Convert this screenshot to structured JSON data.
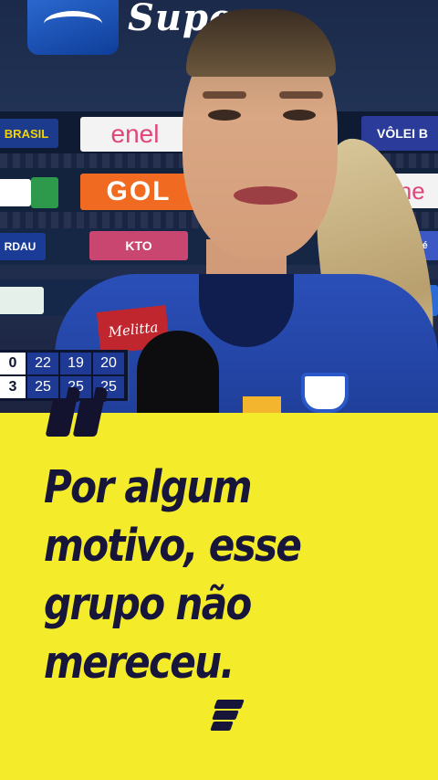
{
  "video": {
    "top_logo_text": "Super",
    "boards": {
      "brasil": "BRASIL",
      "enel1": "enel",
      "volei": "VÔLEI B",
      "red1": "",
      "gol": "GOL",
      "enel2": "ene",
      "rdau": "RDAU",
      "kto": "KTO",
      "itambe": "itambé",
      "red2": ""
    },
    "sponsor": "Melitta",
    "scoreboard": {
      "row1": {
        "sets": "0",
        "points": [
          "22",
          "19",
          "20"
        ]
      },
      "row2": {
        "sets": "3",
        "points": [
          "25",
          "25",
          "25"
        ]
      }
    }
  },
  "quote": {
    "lines": [
      "Por algum",
      "motivo, esse",
      "grupo não",
      "mereceu."
    ]
  },
  "colors": {
    "background": "#f4ec2a",
    "text": "#17163a"
  },
  "icons": {
    "quote": "quote-mark-icon",
    "brand": "brand-s-logo-icon"
  }
}
